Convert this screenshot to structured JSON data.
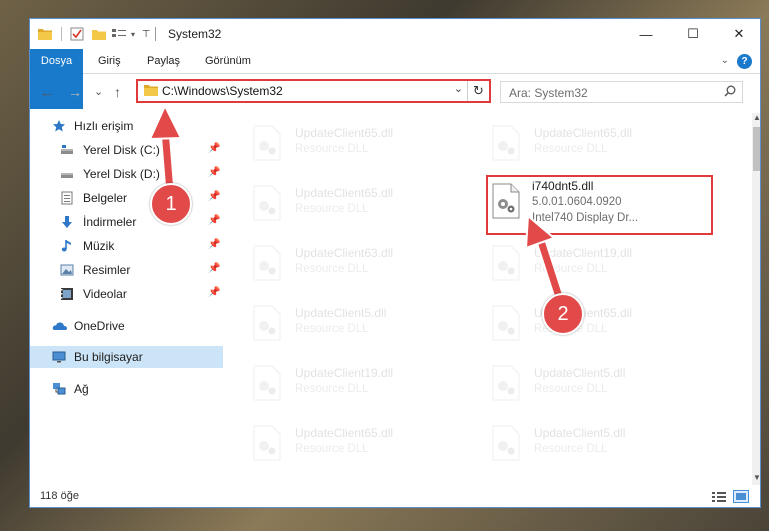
{
  "window": {
    "title": "System32",
    "controls": {
      "minimize": "—",
      "maximize": "☐",
      "close": "✕"
    }
  },
  "ribbon": {
    "tabs": [
      "Dosya",
      "Giriş",
      "Paylaş",
      "Görünüm"
    ],
    "help": "?",
    "expand": "⌄",
    "accent_color": "#1979ca"
  },
  "navbar": {
    "back": "←",
    "forward": "→",
    "recent": "⌄",
    "up": "↑",
    "address": "C:\\Windows\\System32",
    "search_placeholder": "Ara: System32"
  },
  "sidebar": {
    "items": [
      {
        "label": "Hızlı erişim",
        "icon": "star-icon",
        "pinned": false
      },
      {
        "label": "Yerel Disk (C:)",
        "icon": "drive-icon",
        "pinned": true
      },
      {
        "label": "Yerel Disk (D:)",
        "icon": "drive-icon",
        "pinned": true
      },
      {
        "label": "Belgeler",
        "icon": "documents-icon",
        "pinned": true
      },
      {
        "label": "İndirmeler",
        "icon": "download-icon",
        "pinned": true
      },
      {
        "label": "Müzik",
        "icon": "music-icon",
        "pinned": true
      },
      {
        "label": "Resimler",
        "icon": "pictures-icon",
        "pinned": true
      },
      {
        "label": "Videolar",
        "icon": "videos-icon",
        "pinned": true
      },
      {
        "label": "OneDrive",
        "icon": "cloud-icon",
        "pinned": false
      },
      {
        "label": "Bu bilgisayar",
        "icon": "computer-icon",
        "pinned": false,
        "selected": true
      },
      {
        "label": "Ağ",
        "icon": "network-icon",
        "pinned": false
      }
    ]
  },
  "files": {
    "highlighted": {
      "name": "i740dnt5.dll",
      "version": "5.0.01.0604.0920",
      "description": "Intel740 Display Dr..."
    },
    "faded": [
      {
        "name": "UpdateClient65.dll",
        "type": "Resource DLL"
      },
      {
        "name": "UpdateClient65.dll",
        "type": "Resource DLL"
      },
      {
        "name": "UpdateClient65.dll",
        "type": "Resource DLL"
      },
      {
        "name": "UpdateClient63.dll",
        "type": "Resource DLL"
      },
      {
        "name": "UpdateClient19.dll",
        "type": "Resource DLL"
      },
      {
        "name": "UpdateClient5.dll",
        "type": "Resource DLL"
      },
      {
        "name": "UpdateClient65.dll",
        "type": "Resource DLL"
      },
      {
        "name": "UpdateClient19.dll",
        "type": "Resource DLL"
      },
      {
        "name": "UpdateClient5.dll",
        "type": "Resource DLL"
      },
      {
        "name": "UpdateClient65.dll",
        "type": "Resource DLL"
      },
      {
        "name": "UpdateClient5.dll",
        "type": "Resource DLL"
      }
    ]
  },
  "status": {
    "item_count": "118 öğe"
  },
  "callouts": {
    "one": "1",
    "two": "2",
    "color": "#e24a4a"
  }
}
